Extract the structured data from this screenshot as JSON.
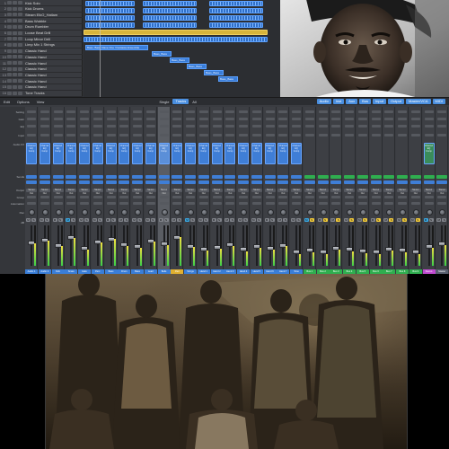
{
  "arrange": {
    "tracks": [
      {
        "num": "1",
        "name": "Kick Solo"
      },
      {
        "num": "2",
        "name": "Kick Drums"
      },
      {
        "num": "3",
        "name": "Steam ElkO_Hatlam"
      },
      {
        "num": "4",
        "name": "Bass Wobble"
      },
      {
        "num": "5",
        "name": "Drum Rumbler"
      },
      {
        "num": "6",
        "name": "Loose Beat Drill"
      },
      {
        "num": "7",
        "name": "Loop Minor Drill"
      },
      {
        "num": "8",
        "name": "Limp Mix 1 Strings"
      },
      {
        "num": "9",
        "name": "Classic Hand"
      },
      {
        "num": "10",
        "name": "Classic Hand"
      },
      {
        "num": "11",
        "name": "Classic Hand"
      },
      {
        "num": "12",
        "name": "Classic Hand"
      },
      {
        "num": "13",
        "name": "Classic Hand"
      },
      {
        "num": "14",
        "name": "Classic Hand"
      },
      {
        "num": "15",
        "name": "Classic Hand"
      },
      {
        "num": "16",
        "name": "Tone Tracks"
      }
    ],
    "regions": {
      "bass_region_label": "Bass, Bass Clave One / Fantasia Ensemble",
      "small_label_1": "Bass_Bass",
      "small_label_2": "Bass_Bass",
      "small_label_3": "Bass_Bass",
      "small_label_4": "Bass_Bass",
      "small_label_5": "Bass_Bass"
    }
  },
  "mixer": {
    "toolbar": {
      "edit": "Edit",
      "options": "Options",
      "view": "View",
      "tabs": [
        "Single",
        "Tracks",
        "All"
      ],
      "filters": [
        "Audio",
        "Inst",
        "Aux",
        "Bus",
        "Input",
        "Output",
        "Master/VCA",
        "MIDI"
      ]
    },
    "row_labels": {
      "setting": "Setting",
      "gain": "Gain",
      "eq": "EQ",
      "input": "Input",
      "audio_fx": "Audio FX",
      "sends": "Sends",
      "output": "Output",
      "group": "Group",
      "automation": "Automation",
      "pan": "Pan",
      "db": "dB"
    },
    "plugin_text": "Channel EQ Comp",
    "output_text": "Stereo Out",
    "channels": [
      {
        "name": "Audio 1",
        "color": "#3a7ed8"
      },
      {
        "name": "Audio 2",
        "color": "#3a7ed8"
      },
      {
        "name": "Kick",
        "color": "#3a7ed8"
      },
      {
        "name": "Snare",
        "color": "#3a7ed8"
      },
      {
        "name": "Hats",
        "color": "#3a7ed8"
      },
      {
        "name": "Perc",
        "color": "#3a7ed8"
      },
      {
        "name": "Bass",
        "color": "#3a7ed8"
      },
      {
        "name": "Drum",
        "color": "#3a7ed8"
      },
      {
        "name": "Bass",
        "color": "#3a7ed8"
      },
      {
        "name": "Lead",
        "color": "#3a7ed8"
      },
      {
        "name": "Bells",
        "color": "#3a7ed8"
      },
      {
        "name": "Pad",
        "color": "#e0b030"
      },
      {
        "name": "Strngs",
        "color": "#3a7ed8"
      },
      {
        "name": "Hand 1",
        "color": "#3a7ed8"
      },
      {
        "name": "Hand 2",
        "color": "#3a7ed8"
      },
      {
        "name": "Hand 3",
        "color": "#3a7ed8"
      },
      {
        "name": "Hand 4",
        "color": "#3a7ed8"
      },
      {
        "name": "Hand 5",
        "color": "#3a7ed8"
      },
      {
        "name": "Hand 6",
        "color": "#3a7ed8"
      },
      {
        "name": "Hand 7",
        "color": "#3a7ed8"
      },
      {
        "name": "Tone",
        "color": "#3a7ed8"
      },
      {
        "name": "Bus 1",
        "color": "#2fae4f"
      },
      {
        "name": "Bus 2",
        "color": "#2fae4f"
      },
      {
        "name": "Bus 3",
        "color": "#2fae4f"
      },
      {
        "name": "Bus 4",
        "color": "#2fae4f"
      },
      {
        "name": "Bus 5",
        "color": "#2fae4f"
      },
      {
        "name": "Bus 6",
        "color": "#2fae4f"
      },
      {
        "name": "Bus 7",
        "color": "#2fae4f"
      },
      {
        "name": "Bus 8",
        "color": "#2fae4f"
      },
      {
        "name": "Bus 9",
        "color": "#2fae4f"
      },
      {
        "name": "Stereo",
        "color": "#c04ad0"
      },
      {
        "name": "Master",
        "color": "#5a6070"
      }
    ]
  },
  "photos": {
    "top_label": "",
    "bottom_label": ""
  },
  "colors": {
    "accent_blue": "#3a7ed8",
    "region_yellow": "#d7b43b",
    "meter_green": "#39d046",
    "solo_yellow": "#f0c93a"
  }
}
